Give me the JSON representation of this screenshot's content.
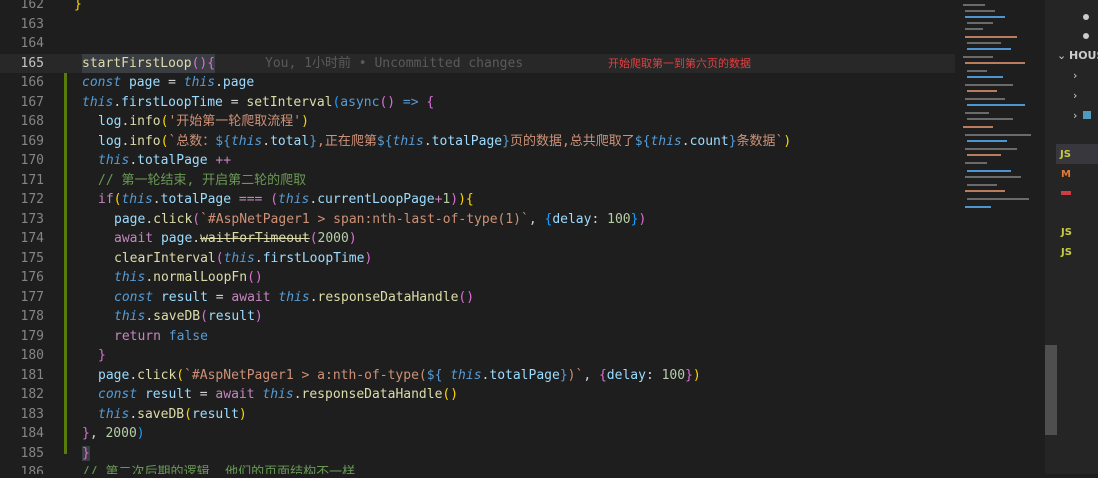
{
  "editor": {
    "lines": [
      {
        "num": "162",
        "code": "}"
      },
      {
        "num": "163",
        "code": ""
      },
      {
        "num": "164",
        "code": ""
      },
      {
        "num": "165",
        "code": "startFirstLoop(){"
      },
      {
        "num": "166",
        "code": "const page = this.page"
      },
      {
        "num": "167",
        "code": "this.firstLoopTime = setInterval(async() => {"
      },
      {
        "num": "168",
        "code": "log.info('开始第一轮爬取流程')"
      },
      {
        "num": "169",
        "code": "log.info(`总数：${this.total},正在爬第${this.totalPage}页的数据,总共爬取了${this.count}条数据`)"
      },
      {
        "num": "170",
        "code": "this.totalPage ++"
      },
      {
        "num": "171",
        "code": "// 第一轮结束, 开启第二轮的爬取"
      },
      {
        "num": "172",
        "code": "if(this.totalPage === (this.currentLoopPage+1)){"
      },
      {
        "num": "173",
        "code": "page.click(`#AspNetPager1 > span:nth-last-of-type(1)`, {delay: 100})"
      },
      {
        "num": "174",
        "code": "await page.waitForTimeout(2000)"
      },
      {
        "num": "175",
        "code": "clearInterval(this.firstLoopTime)"
      },
      {
        "num": "176",
        "code": "this.normalLoopFn()"
      },
      {
        "num": "177",
        "code": "const result = await this.responseDataHandle()"
      },
      {
        "num": "178",
        "code": "this.saveDB(result)"
      },
      {
        "num": "179",
        "code": "return false"
      },
      {
        "num": "180",
        "code": "}"
      },
      {
        "num": "181",
        "code": "page.click(`#AspNetPager1 > a:nth-of-type(${ this.totalPage})`, {delay: 100})"
      },
      {
        "num": "182",
        "code": "const result = await this.responseDataHandle()"
      },
      {
        "num": "183",
        "code": "this.saveDB(result)"
      },
      {
        "num": "184",
        "code": "}, 2000)"
      },
      {
        "num": "185",
        "code": "}"
      },
      {
        "num": "186",
        "code": "// 第二次后期的逻辑, 他们的页面结构不一样"
      }
    ],
    "blame": "You, 1小时前 • Uncommitted changes",
    "annotation": "开始爬取第一到第六页的数据",
    "colors": {
      "background": "#1e1e1e",
      "annotation": "#e04040",
      "git_added": "#587c0c"
    }
  },
  "sidebar": {
    "title": "HOUS",
    "items": [
      "JS",
      "M",
      "JS",
      "JS"
    ]
  }
}
